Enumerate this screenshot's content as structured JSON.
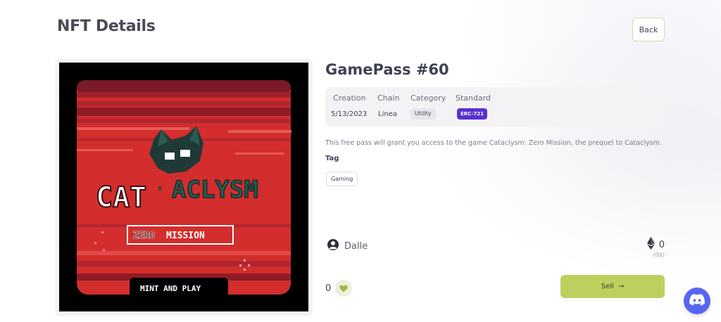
{
  "page": {
    "title": "NFT Details",
    "back_label": "Back"
  },
  "nft": {
    "name": "GamePass #60",
    "image_text": {
      "logo_left": "CAT",
      "logo_right": "ACLYSM",
      "subtitle_left": "ZERO",
      "subtitle_right": "MISSION",
      "cta": "MINT AND PLAY"
    },
    "info": {
      "creation_label": "Creation",
      "creation_value": "5/13/2023",
      "chain_label": "Chain",
      "chain_value": "Linea",
      "category_label": "Category",
      "category_value": "Utility",
      "standard_label": "Standard",
      "standard_value": "ERC-721"
    },
    "description": "This free pass will grant you access to the game Cataclysm: Zero Mission, the prequel to Cataclysm.",
    "tag_heading": "Tag",
    "tags": [
      "Gaming"
    ],
    "owner": "Dalle",
    "price": "0",
    "price_usd": "(0$)",
    "likes": "0",
    "sell_label": "Sell",
    "sell_arrow": "→"
  },
  "icons": {
    "owner": "user-circle-icon",
    "price": "ethereum-icon",
    "like": "heart-icon",
    "discord": "discord-icon"
  },
  "colors": {
    "sell_button": "#bfcf5e",
    "erc_badge": "#5a2fd0",
    "discord": "#5865f2",
    "image_red": "#d32d2d"
  }
}
